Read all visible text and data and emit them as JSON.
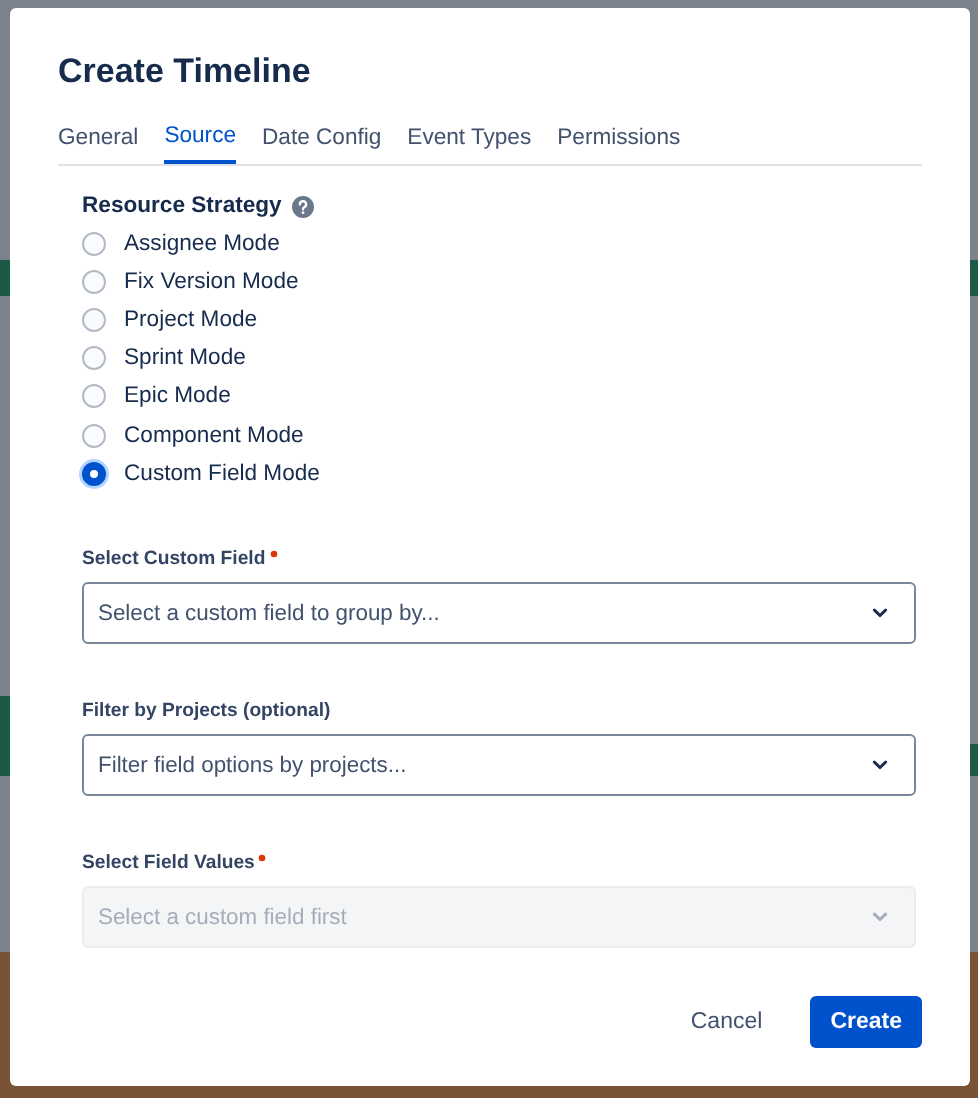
{
  "dialog": {
    "title": "Create Timeline"
  },
  "tabs": [
    {
      "label": "General",
      "selected": false
    },
    {
      "label": "Source",
      "selected": true
    },
    {
      "label": "Date Config",
      "selected": false
    },
    {
      "label": "Event Types",
      "selected": false
    },
    {
      "label": "Permissions",
      "selected": false
    }
  ],
  "resource_strategy": {
    "label": "Resource Strategy",
    "options": [
      {
        "label": "Assignee Mode",
        "selected": false
      },
      {
        "label": "Fix Version Mode",
        "selected": false
      },
      {
        "label": "Project Mode",
        "selected": false
      },
      {
        "label": "Sprint Mode",
        "selected": false
      },
      {
        "label": "Epic Mode",
        "selected": false
      },
      {
        "label": "Component Mode",
        "selected": false
      },
      {
        "label": "Custom Field Mode",
        "selected": true
      }
    ]
  },
  "fields": [
    {
      "label": "Select Custom Field",
      "required": true,
      "placeholder": "Select a custom field to group by...",
      "disabled": false
    },
    {
      "label": "Filter by Projects (optional)",
      "required": false,
      "placeholder": "Filter field options by projects...",
      "disabled": false
    },
    {
      "label": "Select Field Values",
      "required": true,
      "placeholder": "Select a custom field first",
      "disabled": true
    }
  ],
  "buttons": [
    {
      "label": "Cancel",
      "kind": "subtle"
    },
    {
      "label": "Create",
      "kind": "primary"
    }
  ]
}
